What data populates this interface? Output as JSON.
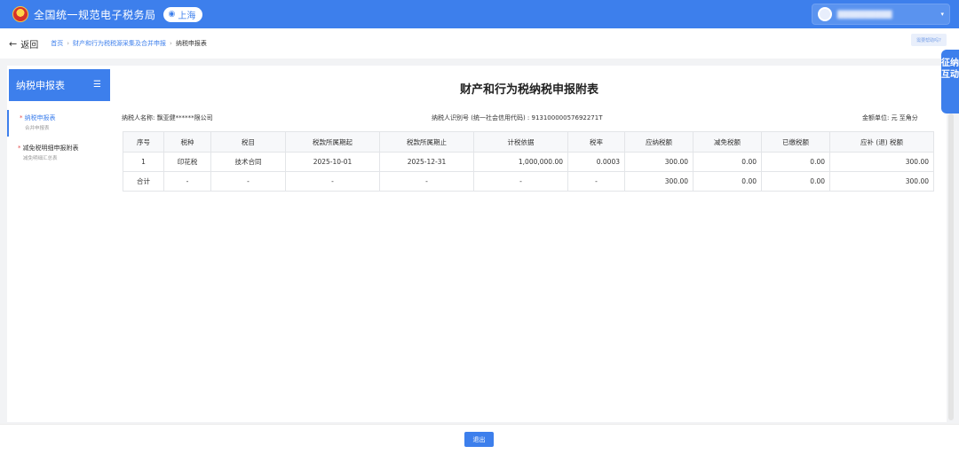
{
  "header": {
    "site_title": "全国统一规范电子税务局",
    "region": "上海",
    "user_name": "██████████",
    "user_caret": "▾"
  },
  "nav": {
    "back_label": "返回",
    "back_arrow": "←",
    "breadcrumbs": [
      "首页",
      "财产和行为税税源采集及合并申报",
      "纳税申报表"
    ],
    "separator": "›",
    "help_label": "需要帮助吗?"
  },
  "sidebar": {
    "title": "纳税申报表",
    "menu_icon": "☰",
    "items": [
      {
        "label": "纳税申报表",
        "sub": "合并申报表",
        "star": "*"
      },
      {
        "label": "减免税明细申报附表",
        "sub": "减免明细汇总表",
        "star": "*"
      }
    ]
  },
  "form": {
    "title": "财产和行为税纳税申报附表",
    "taxpayer_name": "纳税人名称:  飘亚健******限公司",
    "taxpayer_id": "纳税人识别号 (统一社会信用代码) : 91310000057692271T",
    "unit": "金额单位: 元   至角分"
  },
  "table": {
    "headers": [
      "序号",
      "税种",
      "税目",
      "税款所属期起",
      "税款所属期止",
      "计税依据",
      "税率",
      "应纳税额",
      "减免税额",
      "已缴税额",
      "应补 (退) 税额"
    ],
    "rows": [
      [
        "1",
        "印花税",
        "技术合同",
        "2025-10-01",
        "2025-12-31",
        "1,000,000.00",
        "0.0003",
        "300.00",
        "0.00",
        "0.00",
        "300.00"
      ],
      [
        "合计",
        "-",
        "-",
        "-",
        "-",
        "-",
        "-",
        "300.00",
        "0.00",
        "0.00",
        "300.00"
      ]
    ]
  },
  "side_tab": {
    "label": "征纳互动"
  },
  "footer": {
    "exit_label": "退出"
  },
  "icons": {
    "emblem": "national-tax-emblem",
    "pin": "location-pin-icon"
  },
  "colors": {
    "primary": "#3d7fec",
    "star": "#e34d4d"
  }
}
